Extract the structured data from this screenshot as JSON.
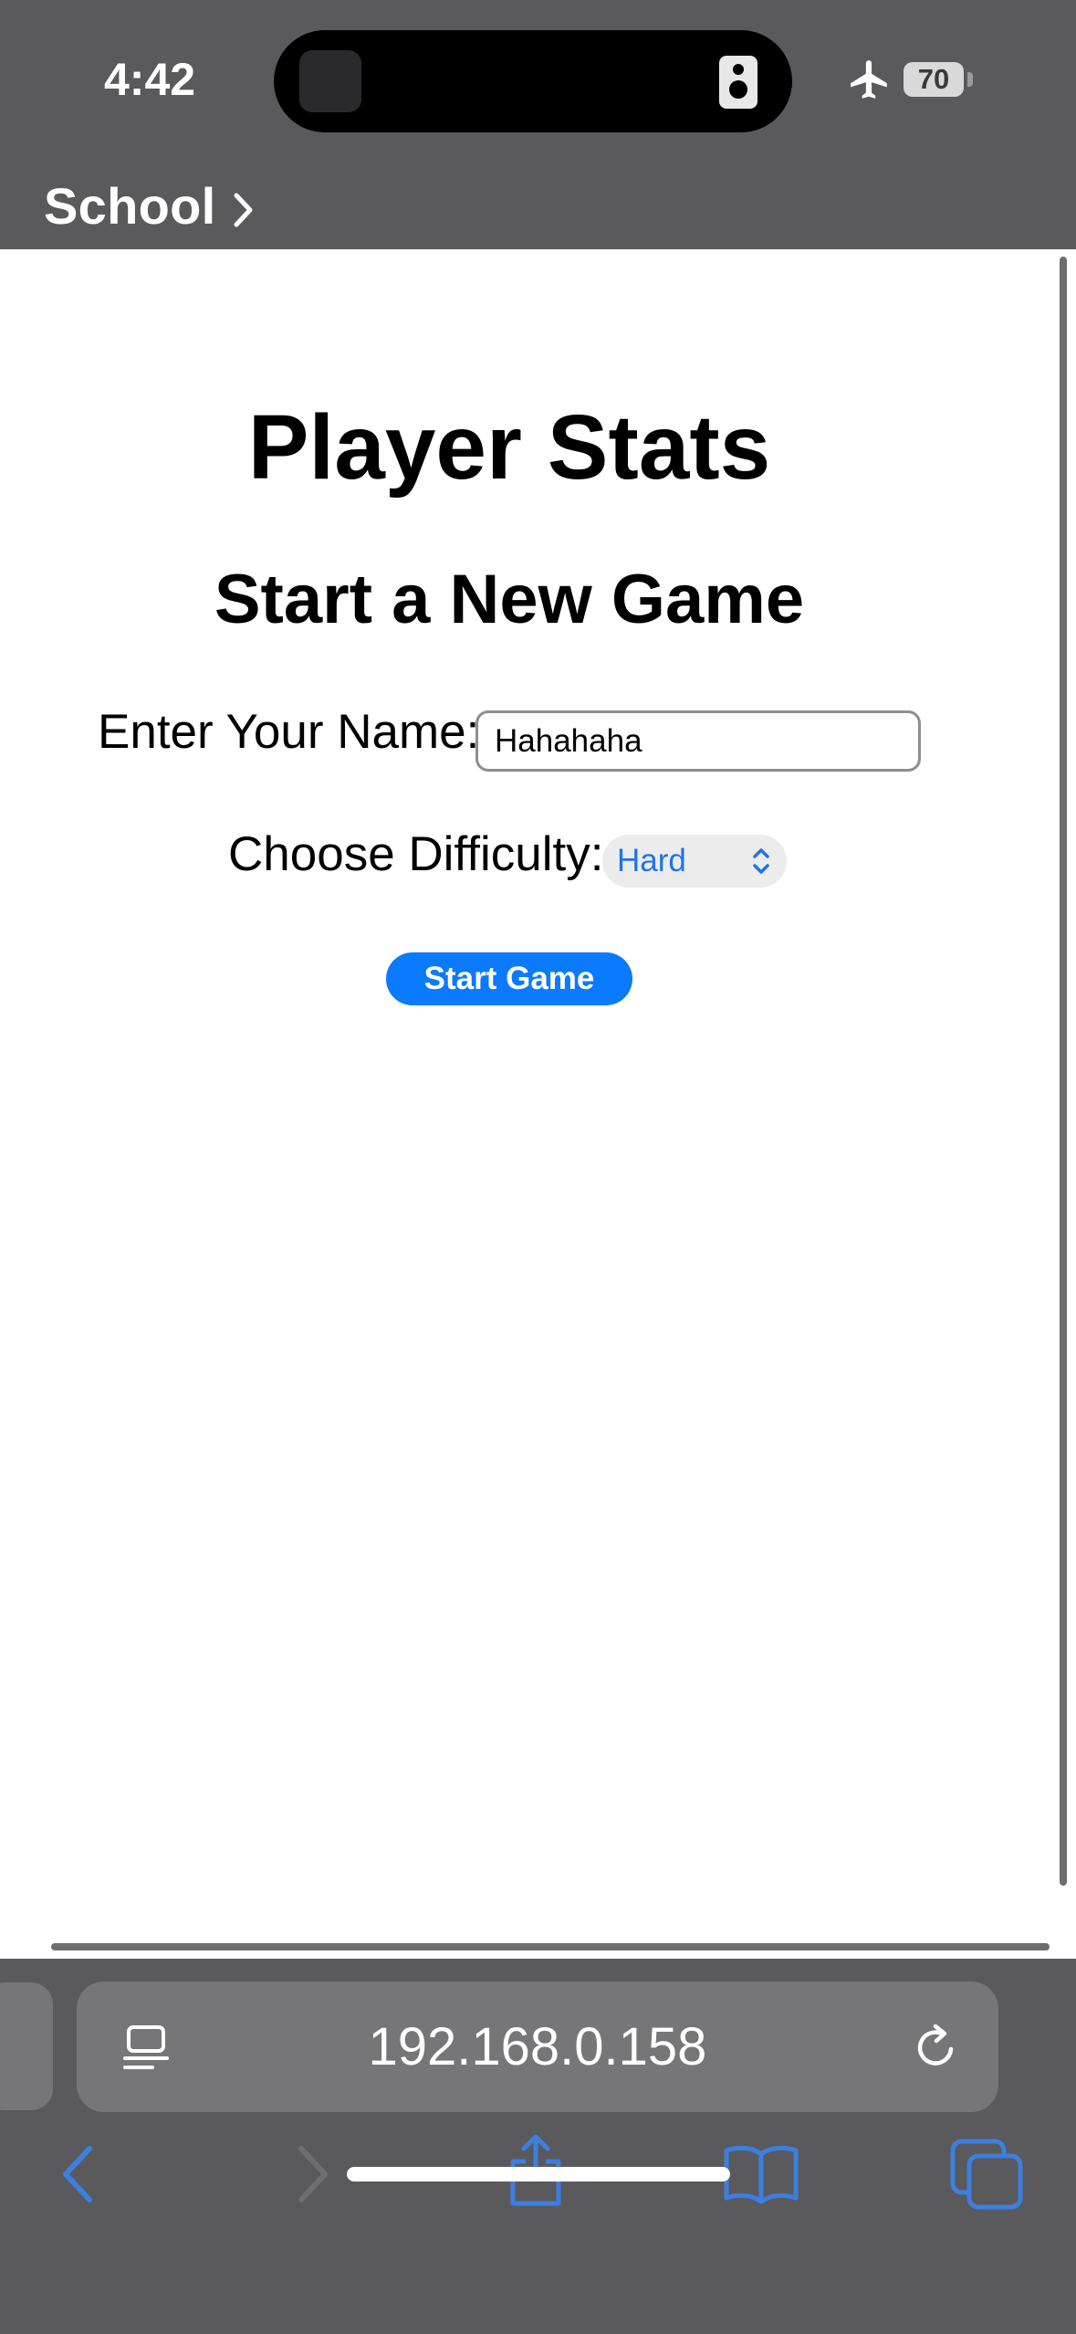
{
  "status_bar": {
    "time": "4:42",
    "battery": "70"
  },
  "app_back": {
    "label": "School"
  },
  "page": {
    "title": "Player Stats",
    "subtitle": "Start a New Game",
    "name_label": "Enter Your Name:",
    "name_value": "Hahahaha",
    "difficulty_label": "Choose Difficulty:",
    "difficulty_value": "Hard",
    "start_button": "Start Game"
  },
  "browser": {
    "url": "192.168.0.158"
  },
  "colors": {
    "accent": "#0a7aff",
    "select_text": "#1f74e8",
    "chrome": "#5a5a5c",
    "toolbar_icon": "#3d7fe0"
  },
  "icons": {
    "status": [
      "airplane-icon",
      "battery-icon"
    ],
    "toolbar": [
      "back-icon",
      "forward-icon",
      "share-icon",
      "bookmarks-icon",
      "tabs-icon"
    ],
    "address_bar": [
      "page-menu-icon",
      "reload-icon"
    ]
  }
}
